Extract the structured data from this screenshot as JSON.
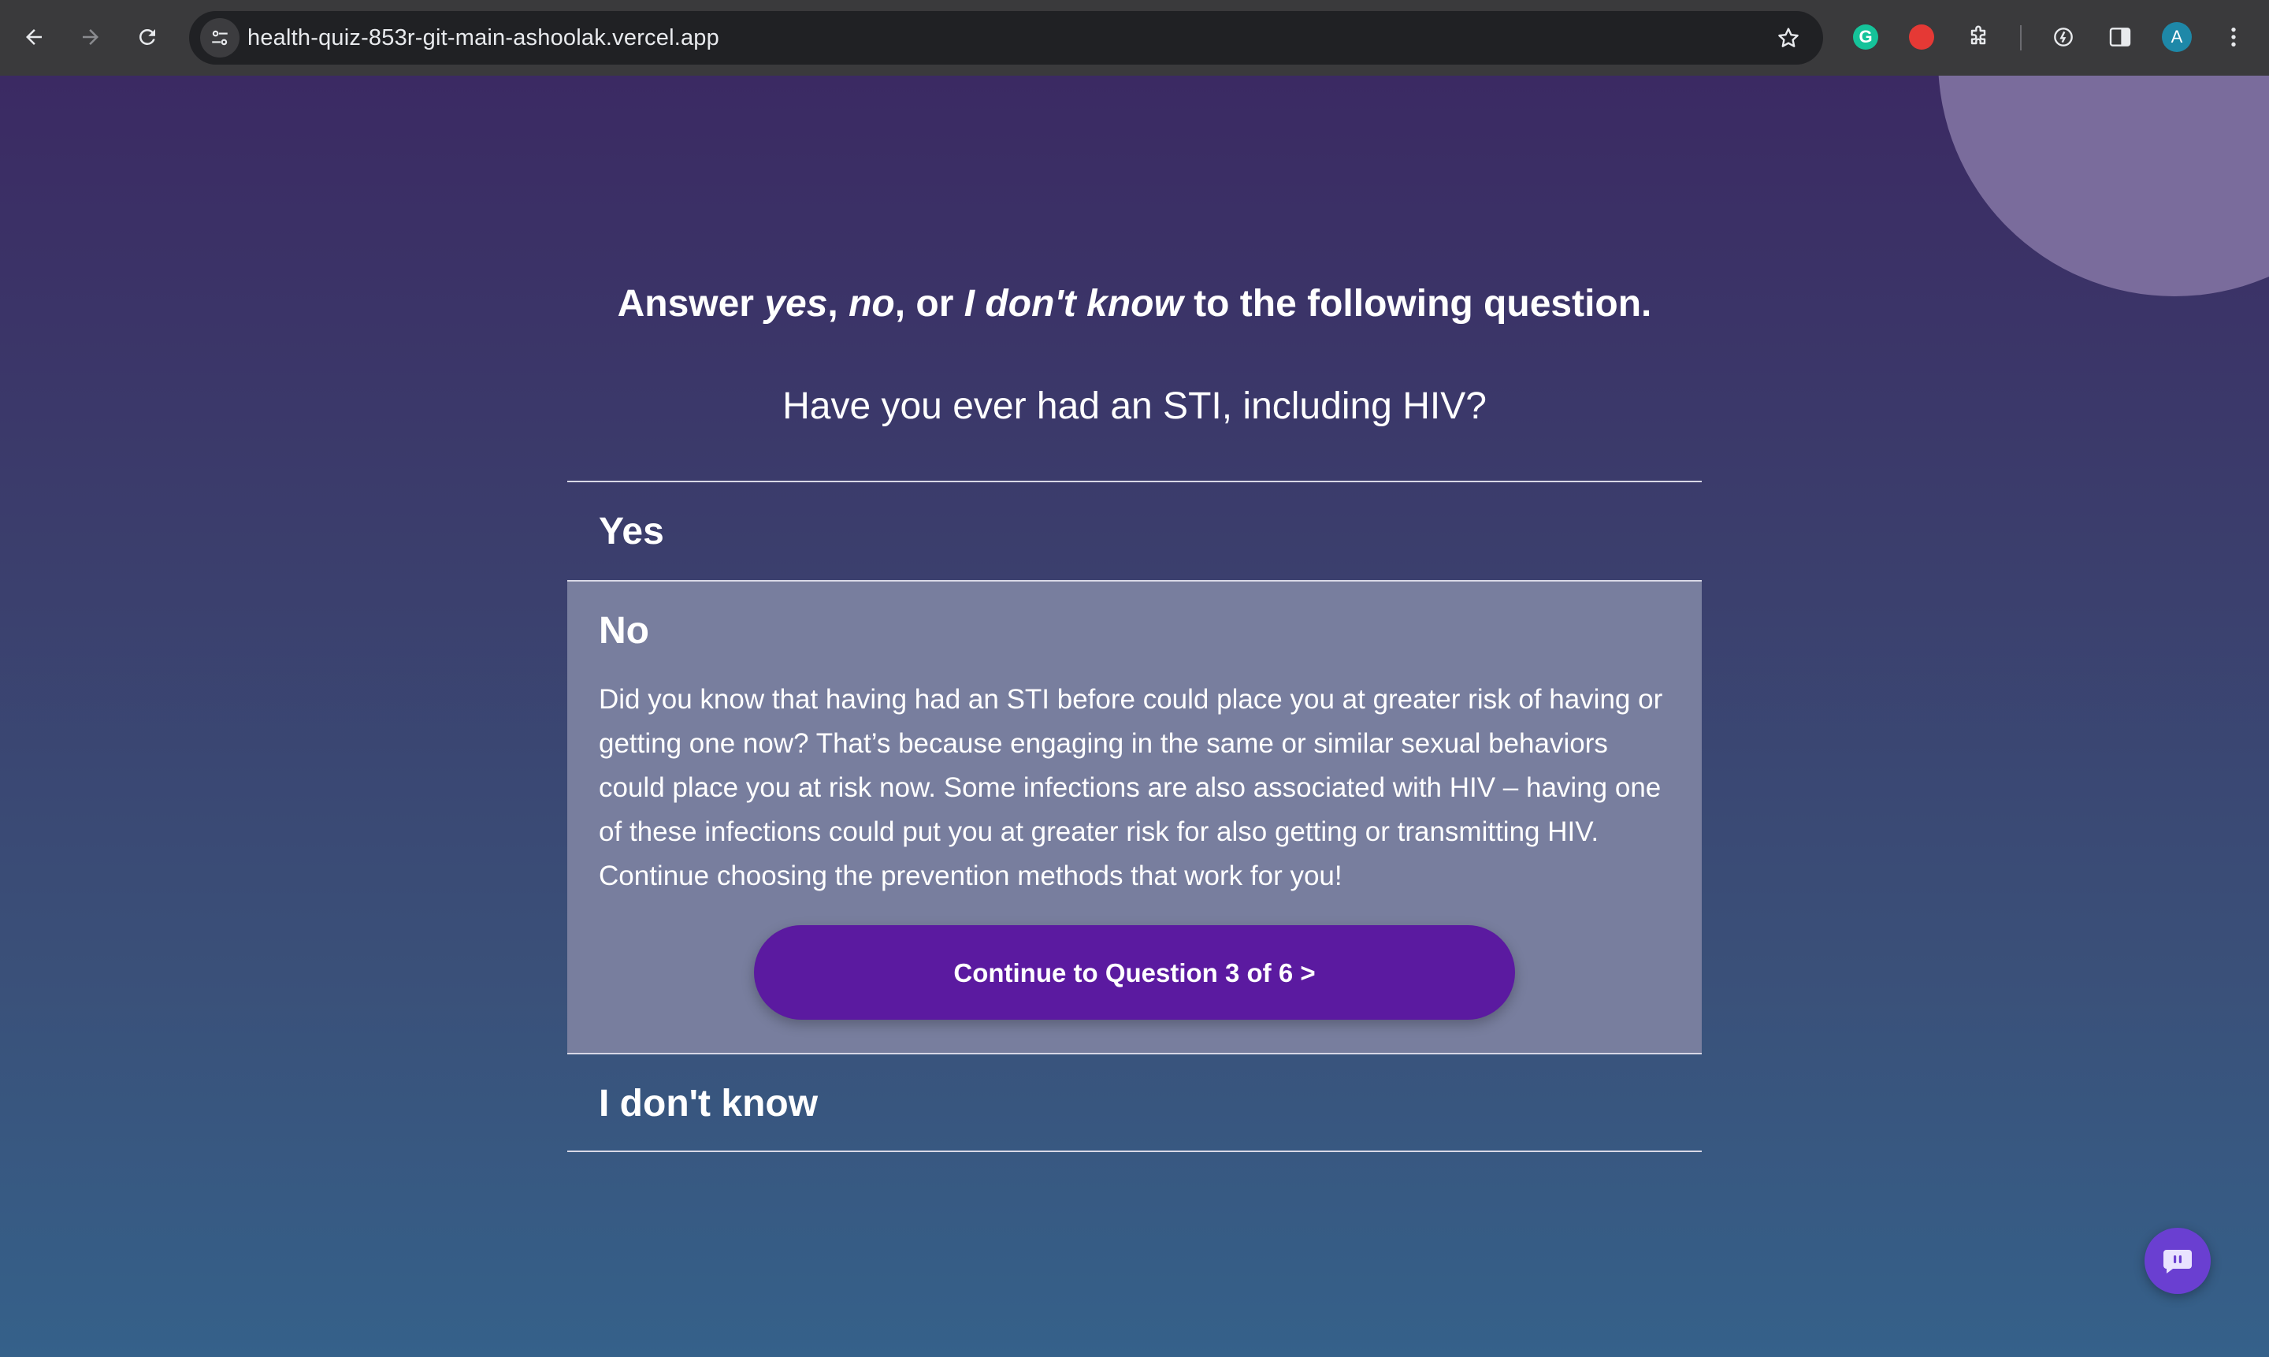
{
  "browser": {
    "url": "health-quiz-853r-git-main-ashoolak.vercel.app",
    "avatar_letter": "A",
    "grammarly_letter": "G"
  },
  "quiz": {
    "instruction": {
      "part1": "Answer ",
      "yes": "yes",
      "sep1": ", ",
      "no": "no",
      "sep2": ", or ",
      "idk": "I don't know",
      "part2": " to the following question."
    },
    "question": "Have you ever had an STI, including HIV?",
    "answers": {
      "yes": {
        "label": "Yes"
      },
      "no": {
        "label": "No",
        "feedback": "Did you know that having had an STI before could place you at greater risk of having or getting one now? That’s because engaging in the same or similar sexual behaviors could place you at risk now. Some infections are also associated with HIV – having one of these infections could put you at greater risk for also getting or transmitting HIV. Continue choosing the prevention methods that work for you!",
        "continue_label": "Continue to Question 3 of 6 >"
      },
      "idk": {
        "label": "I don't know"
      }
    }
  },
  "colors": {
    "button": "#5b1aa0",
    "selected_answer_bg": "#787e9e"
  },
  "icons": {
    "back": "arrow-left-icon",
    "forward": "arrow-right-icon",
    "reload": "reload-icon",
    "site_info": "tune-icon",
    "bookmark": "star-icon",
    "chat": "chat-icon"
  }
}
